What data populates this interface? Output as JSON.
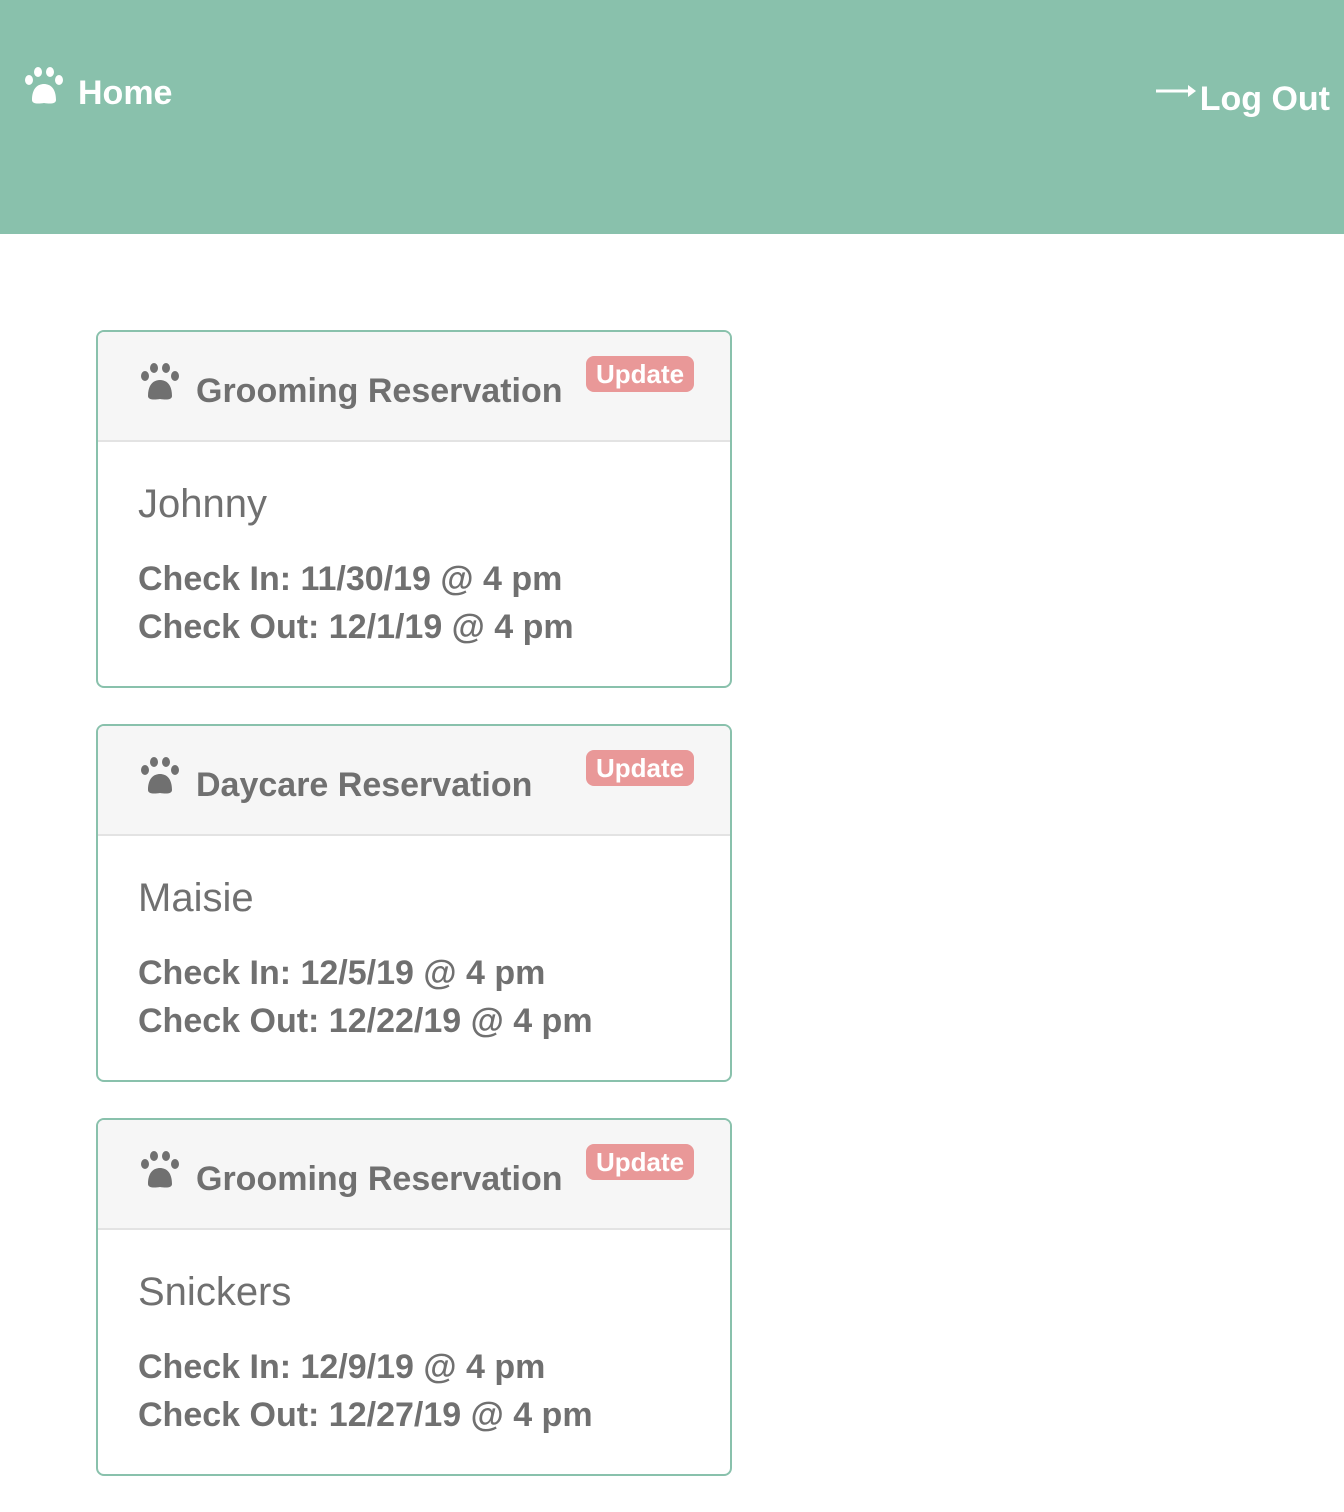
{
  "nav": {
    "home_label": "Home",
    "logout_label": "Log Out",
    "bg_color": "#89c1ac"
  },
  "reservations": [
    {
      "title": "Grooming Reservation",
      "update_label": "Update",
      "pet_name": "Johnny",
      "check_in": "Check In: 11/30/19 @ 4 pm",
      "check_out": "Check Out: 12/1/19 @ 4 pm"
    },
    {
      "title": "Daycare Reservation",
      "update_label": "Update",
      "pet_name": "Maisie",
      "check_in": "Check In: 12/5/19 @ 4 pm",
      "check_out": "Check Out: 12/22/19 @ 4 pm"
    },
    {
      "title": "Grooming Reservation",
      "update_label": "Update",
      "pet_name": "Snickers",
      "check_in": "Check In: 12/9/19 @ 4 pm",
      "check_out": "Check Out: 12/27/19 @ 4 pm"
    }
  ],
  "colors": {
    "accent": "#89c1ac",
    "badge": "#e99898",
    "text": "#707070"
  },
  "icons": {
    "home": "paw-icon",
    "card": "paw-icon",
    "logout": "arrow-right-icon"
  }
}
